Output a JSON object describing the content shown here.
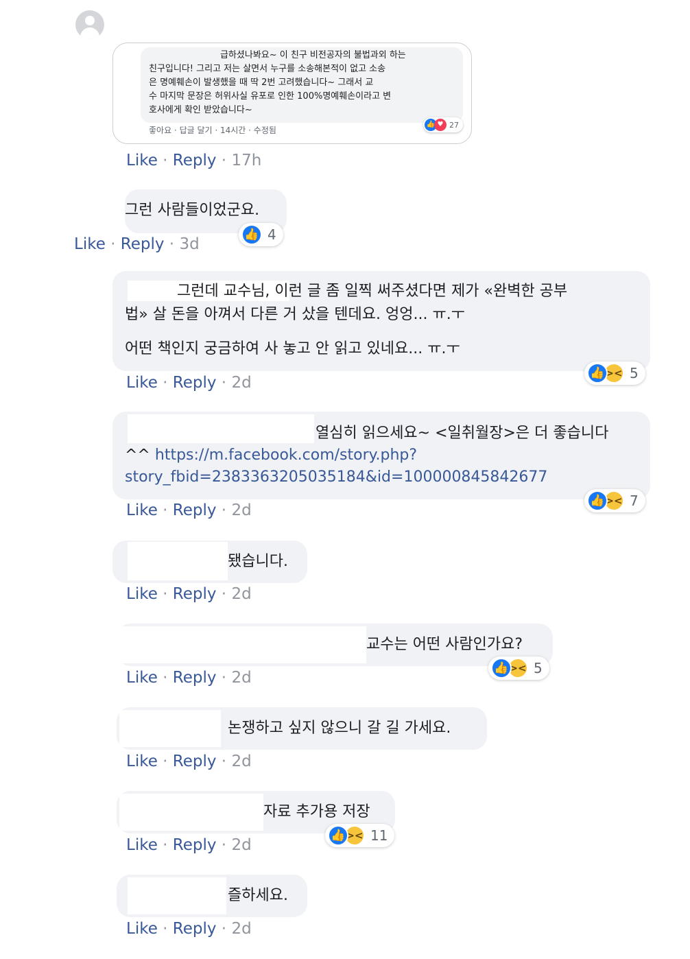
{
  "embedded": {
    "lines": [
      "급하셨나봐요~ 이 친구 비전공자의 불법과외 하는",
      "친구입니다! 그리고 저는 살면서 누구를 소송해본적이 없고 소송",
      "은 명예훼손이 발생했을 때 딱 2번 고려했습니다~ 그래서      교",
      "수 마지막 문장은 허위사실 유포로 인한 100%명예훼손이라고 변",
      "호사에게 확인 받았습니다~"
    ],
    "meta": "좋아요 · 답글 달기 · 14시간 · 수정됨",
    "reaction_count": "27"
  },
  "actions": {
    "like": "Like",
    "reply": "Reply",
    "sep": " · "
  },
  "comments": [
    {
      "time": "17h"
    },
    {
      "text": "그런 사람들이었군요.",
      "time": "3d",
      "reactions": "4"
    },
    {
      "line1": "그런데 교수님, 이런 글 좀 일찍 써주셨다면 제가 «완벽한 공부",
      "line2": "법» 살 돈을 아껴서 다른 거 샀을 텐데요. 엉엉... ㅠ.ㅜ",
      "line3": "어떤 책인지 궁금하여 사 놓고 안 읽고 있네요... ㅠ.ㅜ",
      "time": "2d",
      "reactions": "5"
    },
    {
      "line1": "열심히 읽으세요~ <일취월장>은 더 좋습니다",
      "prefix": "^^ ",
      "url1": "https://m.facebook.com/story.php?",
      "url2": "story_fbid=2383363205035184&id=100000845842677",
      "time": "2d",
      "reactions": "7"
    },
    {
      "text": "됐습니다.",
      "time": "2d"
    },
    {
      "text": "교수는 어떤 사람인가요?",
      "time": "2d",
      "reactions": "5"
    },
    {
      "text": "논쟁하고 싶지 않으니 갈 길 가세요.",
      "time": "2d"
    },
    {
      "text": "자료 추가용 저장",
      "time": "2d",
      "reactions": "11"
    },
    {
      "text": "즐하세요.",
      "time": "2d"
    }
  ]
}
